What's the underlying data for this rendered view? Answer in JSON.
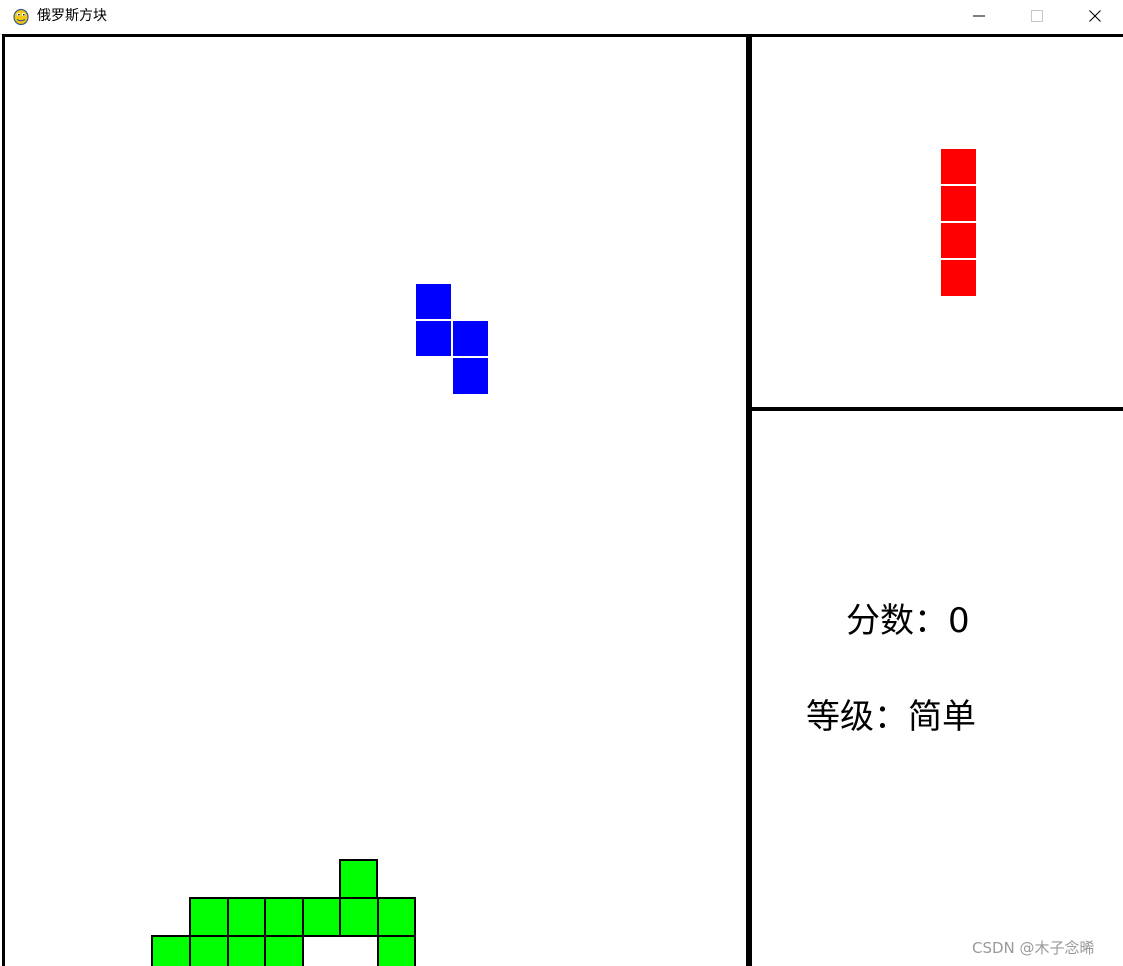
{
  "window": {
    "title": "俄罗斯方块",
    "icon": "pygame-snake-icon",
    "controls": [
      "minimize-icon",
      "maximize-icon",
      "close-icon"
    ]
  },
  "colors": {
    "current_piece": "#0000ff",
    "next_piece": "#ff0000",
    "stacked_blocks": "#00ff00",
    "panel_border": "#000000"
  },
  "current_piece": {
    "shape": "S",
    "color": "#0000ff"
  },
  "next_piece": {
    "shape": "I",
    "color": "#ff0000"
  },
  "info": {
    "score_label": "分数：",
    "score_value": "0",
    "level_label": "等级：",
    "level_value": "简单"
  },
  "watermark": "CSDN @木子念晞"
}
